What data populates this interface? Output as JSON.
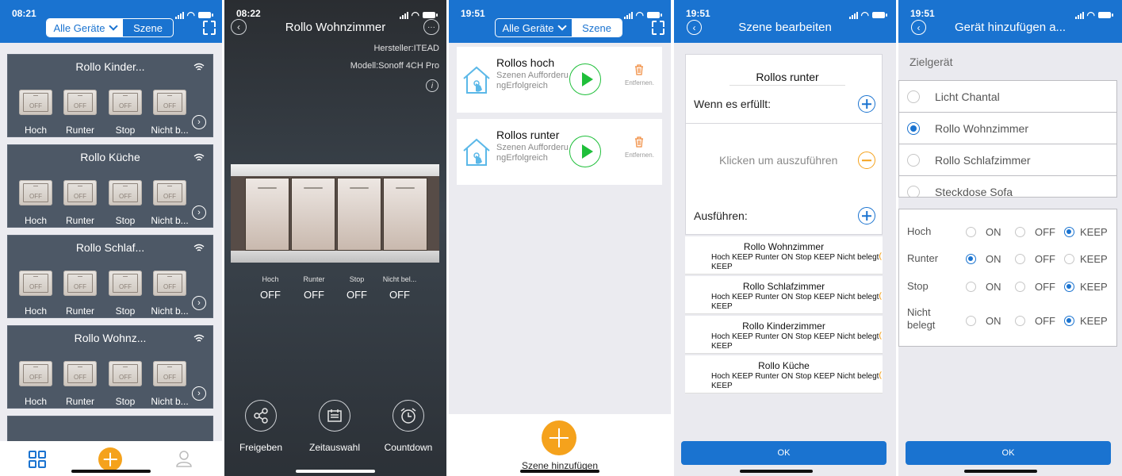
{
  "colors": {
    "primary": "#1a73d0",
    "accent": "#f5a21c",
    "play": "#1fbf3a",
    "card": "#4d5866"
  },
  "screen1": {
    "status_time": "08:21",
    "segment": {
      "devices": "Alle Geräte",
      "scenes": "Szene"
    },
    "devices": [
      {
        "name": "Rollo Kinder...",
        "channels": [
          "Hoch",
          "Runter",
          "Stop",
          "Nicht b..."
        ],
        "states": [
          "OFF",
          "OFF",
          "OFF",
          "OFF"
        ]
      },
      {
        "name": "Rollo Küche",
        "channels": [
          "Hoch",
          "Runter",
          "Stop",
          "Nicht b..."
        ],
        "states": [
          "OFF",
          "OFF",
          "OFF",
          "OFF"
        ]
      },
      {
        "name": "Rollo Schlaf...",
        "channels": [
          "Hoch",
          "Runter",
          "Stop",
          "Nicht b..."
        ],
        "states": [
          "OFF",
          "OFF",
          "OFF",
          "OFF"
        ]
      },
      {
        "name": "Rollo Wohnz...",
        "channels": [
          "Hoch",
          "Runter",
          "Stop",
          "Nicht b..."
        ],
        "states": [
          "OFF",
          "OFF",
          "OFF",
          "OFF"
        ]
      }
    ]
  },
  "screen2": {
    "status_time": "08:22",
    "title": "Rollo Wohnzimmer",
    "manufacturer": "Hersteller:ITEAD",
    "model": "Modell:Sonoff 4CH Pro",
    "channels": [
      {
        "label": "Hoch",
        "state": "OFF"
      },
      {
        "label": "Runter",
        "state": "OFF"
      },
      {
        "label": "Stop",
        "state": "OFF"
      },
      {
        "label": "Nicht bel...",
        "state": "OFF"
      }
    ],
    "actions": [
      "Freigeben",
      "Zeitauswahl",
      "Countdown"
    ]
  },
  "screen3": {
    "status_time": "19:51",
    "segment": {
      "devices": "Alle Geräte",
      "scenes": "Szene"
    },
    "scenes": [
      {
        "name": "Rollos hoch",
        "subtitle": "Szenen AufforderungErfolgreich",
        "remove": "Entfernen."
      },
      {
        "name": "Rollos runter",
        "subtitle": "Szenen AufforderungErfolgreich",
        "remove": "Entfernen."
      }
    ],
    "add_label": "Szene hinzufügen"
  },
  "screen4": {
    "status_time": "19:51",
    "title": "Szene bearbeiten",
    "scene_name": "Rollos runter",
    "condition_label": "Wenn es erfüllt:",
    "condition_value": "Klicken um auszuführen",
    "execute_label": "Ausführen:",
    "actions": [
      {
        "device": "Rollo Wohnzimmer",
        "desc": "Hoch KEEP Runter ON Stop KEEP Nicht belegt KEEP"
      },
      {
        "device": "Rollo Schlafzimmer",
        "desc": "Hoch KEEP Runter ON Stop KEEP Nicht belegt KEEP"
      },
      {
        "device": "Rollo Kinderzimmer",
        "desc": "Hoch KEEP Runter ON Stop KEEP Nicht belegt KEEP"
      },
      {
        "device": "Rollo Küche",
        "desc": "Hoch KEEP Runter ON Stop KEEP Nicht belegt KEEP"
      }
    ],
    "ok": "OK"
  },
  "screen5": {
    "status_time": "19:51",
    "title": "Gerät hinzufügen a...",
    "target_label": "Zielgerät",
    "devices": [
      {
        "name": "Licht Chantal",
        "selected": false
      },
      {
        "name": "Rollo Wohnzimmer",
        "selected": true
      },
      {
        "name": "Rollo Schlafzimmer",
        "selected": false
      },
      {
        "name": "Steckdose Sofa",
        "selected": false
      }
    ],
    "options": [
      "ON",
      "OFF",
      "KEEP"
    ],
    "channels": [
      {
        "name": "Hoch",
        "value": "KEEP"
      },
      {
        "name": "Runter",
        "value": "ON"
      },
      {
        "name": "Stop",
        "value": "KEEP"
      },
      {
        "name": "Nicht belegt",
        "value": "KEEP"
      }
    ],
    "ok": "OK"
  }
}
